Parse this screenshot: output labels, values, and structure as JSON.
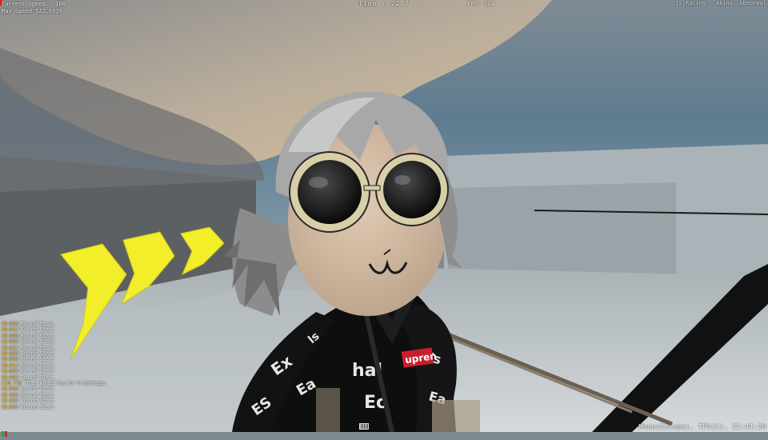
{
  "hud": {
    "speed_lines": [
      "Current Speed : 100",
      "Max Speed:522.6939"
    ],
    "timer_label": "Time :",
    "timer_value": "22.7",
    "fps": "FPS: 204",
    "server": "[S]Racing - Akina: Abnormal"
  },
  "chat": [
    {
      "ts": "(0.00)",
      "msg": "Round Start."
    },
    {
      "ts": "(0.01)",
      "msg": "Round Start."
    },
    {
      "ts": "(0.00)",
      "msg": "Round Start."
    },
    {
      "ts": "(0.00)",
      "msg": "Round Start."
    },
    {
      "ts": "(0.01)",
      "msg": "Round Start."
    },
    {
      "ts": "(0.00)",
      "msg": "Round Start."
    },
    {
      "ts": "(0.00)",
      "msg": "Round Start."
    },
    {
      "ts": "(0.01)",
      "msg": "Round Start."
    },
    {
      "ts": "(0.00)",
      "msg": "Round Start."
    },
    {
      "ts": "(0.00)",
      "msg": "Round Start."
    },
    {
      "ts": "(19.73)",
      "msg": "Titan killed You for 0 damage."
    },
    {
      "ts": "(0.00)",
      "msg": "Round Start."
    },
    {
      "ts": "(0.00)",
      "msg": "Round Start."
    },
    {
      "ts": "(0.00)",
      "msg": "Round Start."
    },
    {
      "ts": "(0.00)",
      "msg": "Round Start."
    }
  ],
  "footer": "Menu(Escape), TPS(C), 22:41:20",
  "shirt_logo": "Supreme",
  "colors": {
    "sky_blue": "#5d7a90",
    "cloud": "#c9b89f",
    "floor": "#c9cfd2",
    "arrow_yellow": "#f2ee2a",
    "shirt_logo_red": "#c8202a"
  }
}
